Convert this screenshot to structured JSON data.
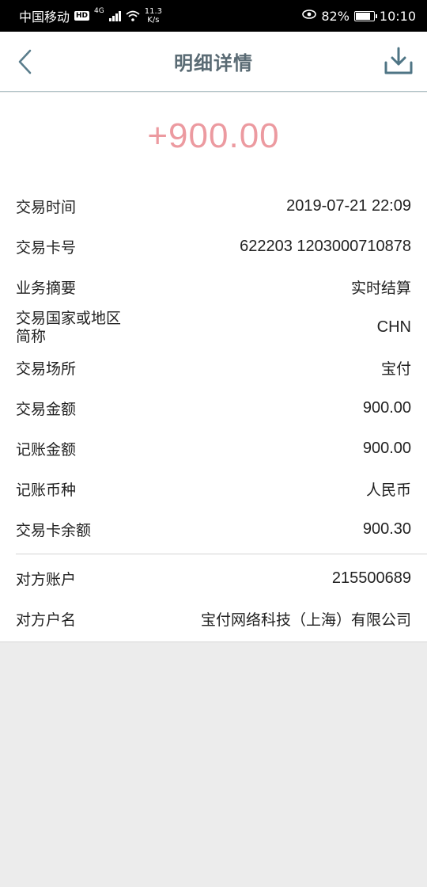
{
  "status_bar": {
    "carrier": "中国移动",
    "hd": "HD",
    "net_type": "4G",
    "speed_value": "11.3",
    "speed_unit": "K/s",
    "battery": "82%",
    "time": "10:10"
  },
  "header": {
    "title": "明细详情",
    "back_icon": "chevron-left-icon",
    "download_icon": "download-icon"
  },
  "amount": "+900.00",
  "amount_color": "#ec9aa0",
  "details": [
    {
      "label": "交易时间",
      "value": "2019-07-21 22:09"
    },
    {
      "label": "交易卡号",
      "value": "622203 1203000710878"
    },
    {
      "label": "业务摘要",
      "value": "实时结算"
    },
    {
      "label_line1": "交易国家或地区",
      "label_line2": "简称",
      "value": "CHN"
    },
    {
      "label": "交易场所",
      "value": "宝付"
    },
    {
      "label": "交易金额",
      "value": "900.00"
    },
    {
      "label": "记账金额",
      "value": "900.00"
    },
    {
      "label": "记账币种",
      "value": "人民币"
    },
    {
      "label": "交易卡余额",
      "value": "900.30"
    }
  ],
  "counterparty": [
    {
      "label": "对方账户",
      "value": "215500689"
    },
    {
      "label": "对方户名",
      "value": "宝付网络科技（上海）有限公司"
    }
  ]
}
